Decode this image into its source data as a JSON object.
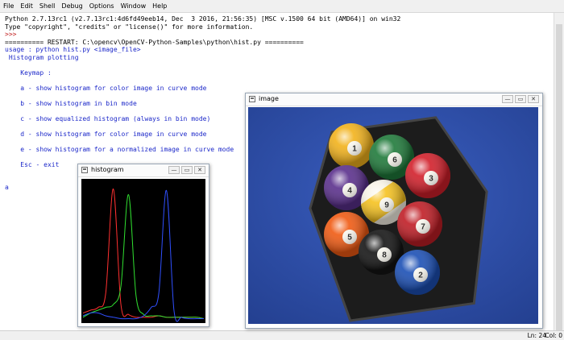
{
  "menu": [
    "File",
    "Edit",
    "Shell",
    "Debug",
    "Options",
    "Window",
    "Help"
  ],
  "shell": {
    "lines": [
      {
        "text": "Python 2.7.13rc1 (v2.7.13rc1:4d6fd49eeb14, Dec  3 2016, 21:56:35) [MSC v.1500 64 bit (AMD64)] on win32",
        "color": "#000000"
      },
      {
        "text": "Type \"copyright\", \"credits\" or \"license()\" for more information.",
        "color": "#000000"
      },
      {
        "text": ">>> ",
        "color": "#c21f1f"
      },
      {
        "text": "========== RESTART: C:\\opencv\\OpenCV-Python-Samples\\python\\hist.py ==========",
        "color": "#000000"
      },
      {
        "text": "usage : python hist.py <image_file>",
        "color": "#1b27c9"
      },
      {
        "text": " Histogram plotting",
        "color": "#1b27c9"
      },
      {
        "text": "",
        "color": "#1b27c9"
      },
      {
        "text": "    Keymap :",
        "color": "#1b27c9"
      },
      {
        "text": "",
        "color": "#1b27c9"
      },
      {
        "text": "    a - show histogram for color image in curve mode",
        "color": "#1b27c9"
      },
      {
        "text": "",
        "color": "#1b27c9"
      },
      {
        "text": "    b - show histogram in bin mode",
        "color": "#1b27c9"
      },
      {
        "text": "",
        "color": "#1b27c9"
      },
      {
        "text": "    c - show equalized histogram (always in bin mode)",
        "color": "#1b27c9"
      },
      {
        "text": "",
        "color": "#1b27c9"
      },
      {
        "text": "    d - show histogram for color image in curve mode",
        "color": "#1b27c9"
      },
      {
        "text": "",
        "color": "#1b27c9"
      },
      {
        "text": "    e - show histogram for a normalized image in curve mode",
        "color": "#1b27c9"
      },
      {
        "text": "",
        "color": "#1b27c9"
      },
      {
        "text": "    Esc - exit",
        "color": "#1b27c9"
      },
      {
        "text": "",
        "color": "#1b27c9"
      },
      {
        "text": "",
        "color": "#1b27c9"
      },
      {
        "text": "a",
        "color": "#1b27c9"
      }
    ]
  },
  "status": {
    "line": "Ln: 24",
    "col": "Col: 0"
  },
  "histogram_window": {
    "title": "histogram",
    "buttons": [
      "—",
      "▭",
      "✕"
    ]
  },
  "image_window": {
    "title": "image",
    "buttons": [
      "—",
      "▭",
      "✕"
    ]
  },
  "photo": {
    "background": "#2e50a8",
    "balls": [
      {
        "number": "1",
        "color": "#f2b21b",
        "stripe": false
      },
      {
        "number": "6",
        "color": "#1f7a3a",
        "stripe": false
      },
      {
        "number": "3",
        "color": "#d21f2a",
        "stripe": false
      },
      {
        "number": "4",
        "color": "#5a2f8c",
        "stripe": false
      },
      {
        "number": "9",
        "color": "#f6c21f",
        "stripe": true
      },
      {
        "number": "7",
        "color": "#c01d25",
        "stripe": false
      },
      {
        "number": "5",
        "color": "#f05a12",
        "stripe": false
      },
      {
        "number": "8",
        "color": "#141414",
        "stripe": false
      },
      {
        "number": "2",
        "color": "#1b4fb5",
        "stripe": false
      }
    ]
  },
  "chart_data": {
    "type": "line",
    "x": [
      0,
      16,
      32,
      48,
      64,
      80,
      96,
      112,
      128,
      144,
      160,
      176,
      192,
      208,
      224,
      240,
      255
    ],
    "series": [
      {
        "color": "#ff3030",
        "values": [
          0.06,
          0.08,
          0.1,
          0.2,
          0.94,
          0.12,
          0.05,
          0.03,
          0.03,
          0.03,
          0.04,
          0.03,
          0.03,
          0.03,
          0.03,
          0.03,
          0.02
        ]
      },
      {
        "color": "#30e030",
        "values": [
          0.03,
          0.06,
          0.08,
          0.1,
          0.12,
          0.25,
          0.9,
          0.18,
          0.05,
          0.04,
          0.04,
          0.03,
          0.03,
          0.03,
          0.03,
          0.03,
          0.02
        ]
      },
      {
        "color": "#3050ff",
        "values": [
          0.04,
          0.06,
          0.06,
          0.04,
          0.03,
          0.02,
          0.02,
          0.02,
          0.04,
          0.1,
          0.2,
          0.93,
          0.08,
          0.03,
          0.02,
          0.02,
          0.02
        ]
      }
    ],
    "ylim": [
      0,
      1
    ]
  }
}
